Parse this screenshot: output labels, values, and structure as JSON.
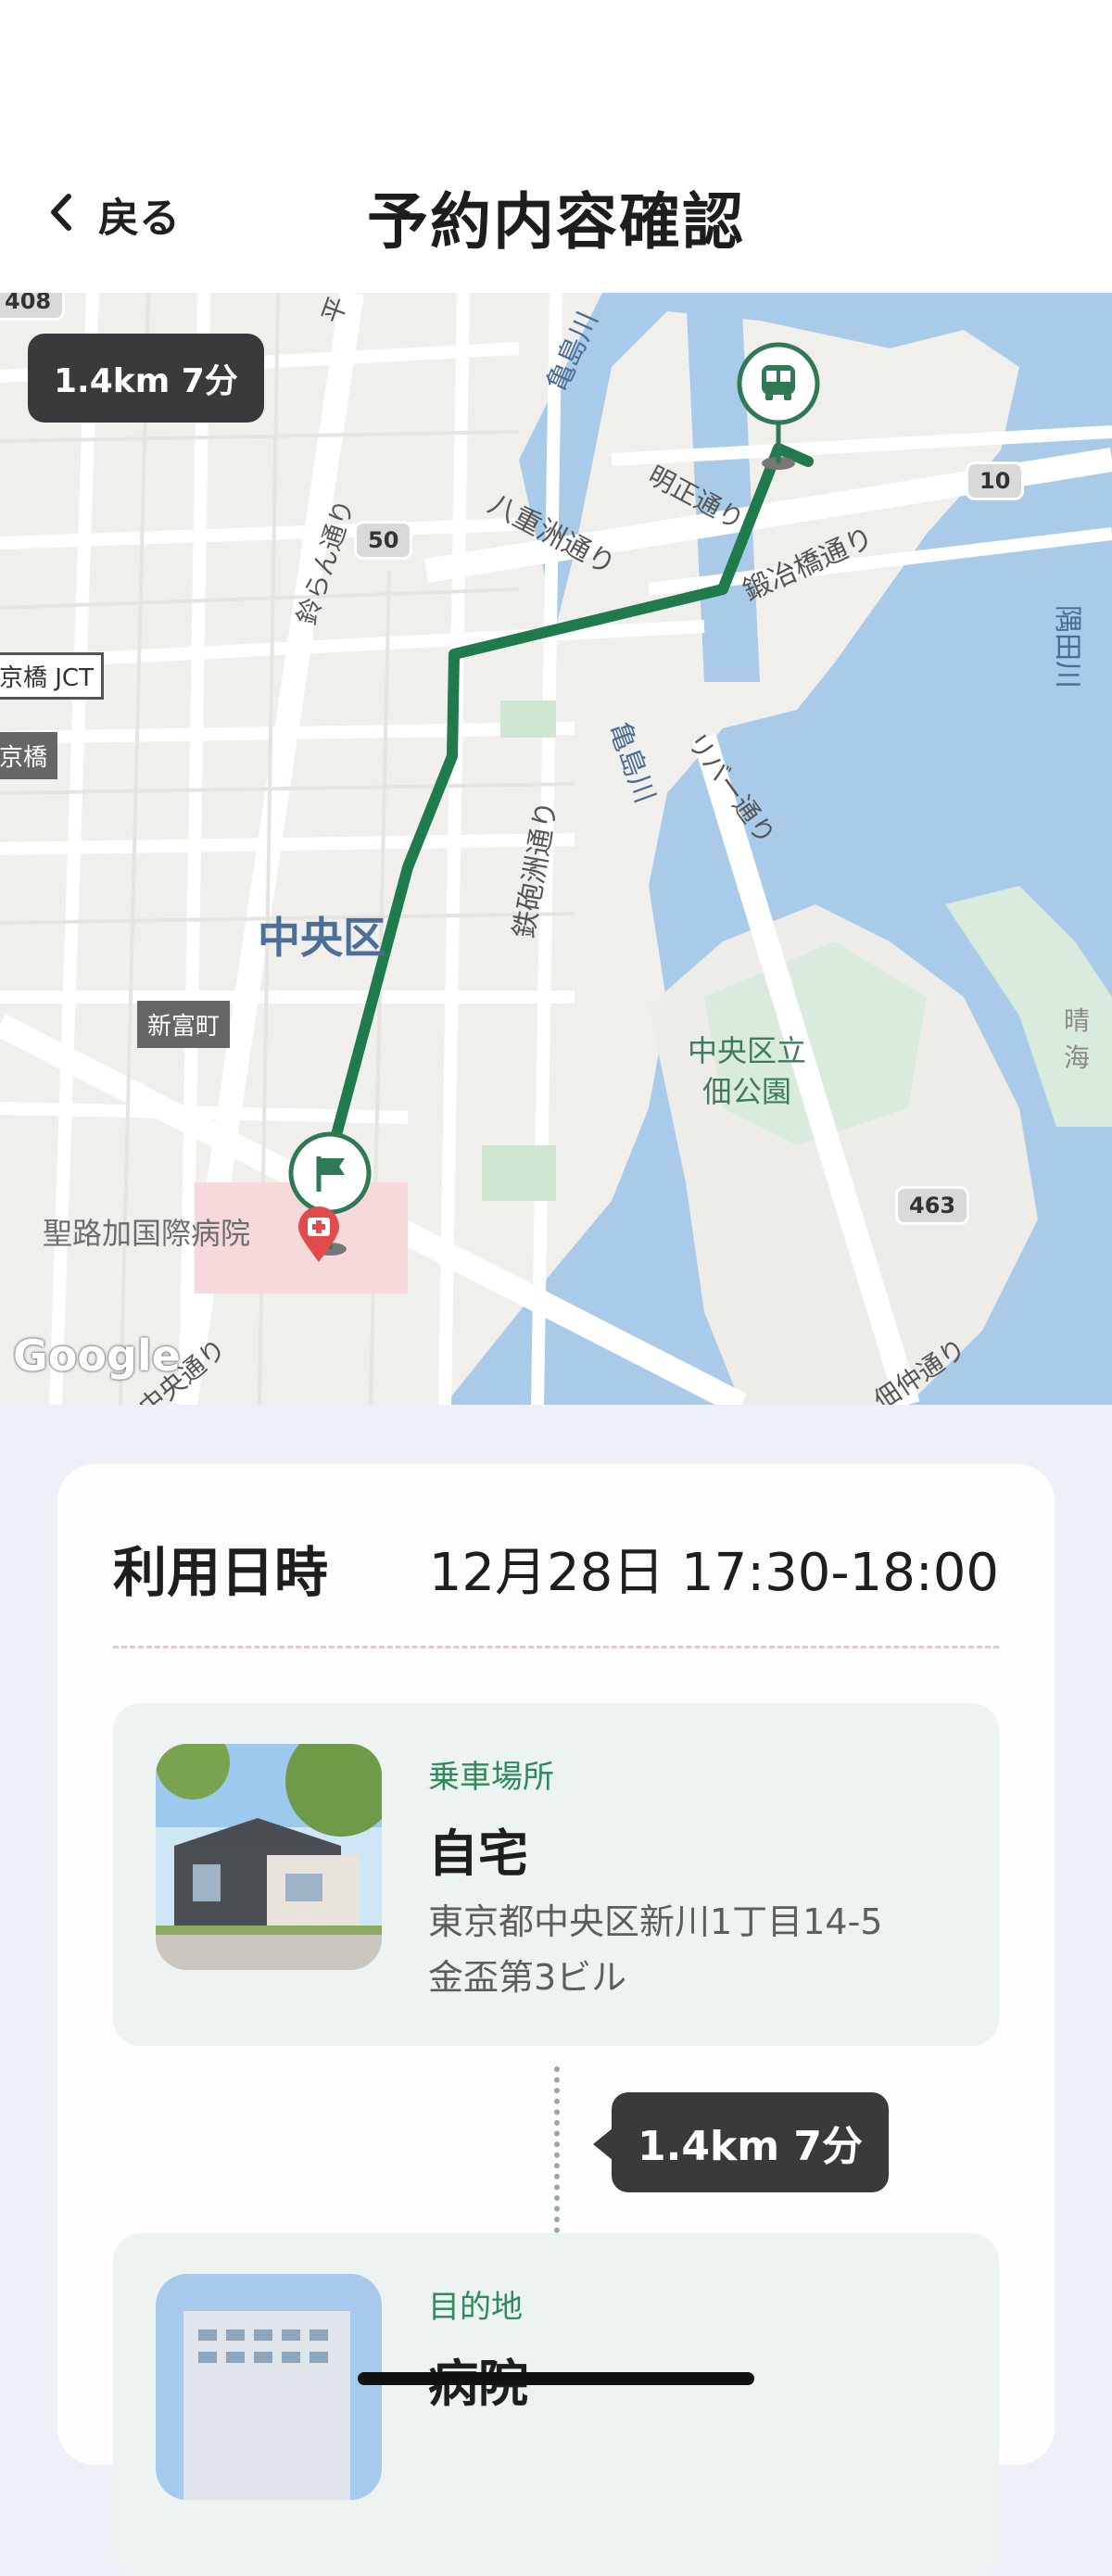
{
  "header": {
    "back_label": "戻る",
    "title": "予約内容確認"
  },
  "map": {
    "distance_time": "1.4km 7分",
    "attribution": "Google",
    "labels": {
      "road_408": "408",
      "road_50": "50",
      "road_10": "10",
      "road_463": "463",
      "suzuran": "鈴らん通り",
      "yaesu": "八重洲通り",
      "meisho": "明正通り",
      "kajibashi": "鍛冶橋通り",
      "kameshima_top": "亀島川",
      "kameshima_mid": "亀島川",
      "river_street": "リバー通り",
      "teppozu": "鉄砲洲通り",
      "sumida": "隅田川",
      "kyobashi_jct": "京橋 JCT",
      "kyobashi": "京橋",
      "chuo_ku": "中央区",
      "shintomi": "新富町",
      "park": "中央区立\n佃公園",
      "harumi": "晴海",
      "hospital": "聖路加国際病院",
      "tsukuda": "佃仲通り",
      "chuo_st": "中央通り",
      "hei": "平"
    }
  },
  "booking": {
    "datetime_label": "利用日時",
    "datetime_value": "12月28日 17:30-18:00",
    "pickup": {
      "kind": "乗車場所",
      "name": "自宅",
      "address_line1": "東京都中央区新川1丁目14-5",
      "address_line2": "金盃第3ビル"
    },
    "segment_distance_time": "1.4km 7分",
    "destination": {
      "kind": "目的地",
      "name": "病院"
    }
  },
  "colors": {
    "route": "#1f7a4c",
    "accent_green": "#2f8a5c",
    "pill_bg": "#3a3a3c",
    "water": "#a9cbe9"
  },
  "icons": {
    "back": "chevron-left-icon",
    "pickup_pin": "bus-icon",
    "destination_pin": "flag-icon",
    "hospital_marker": "hospital-icon"
  }
}
